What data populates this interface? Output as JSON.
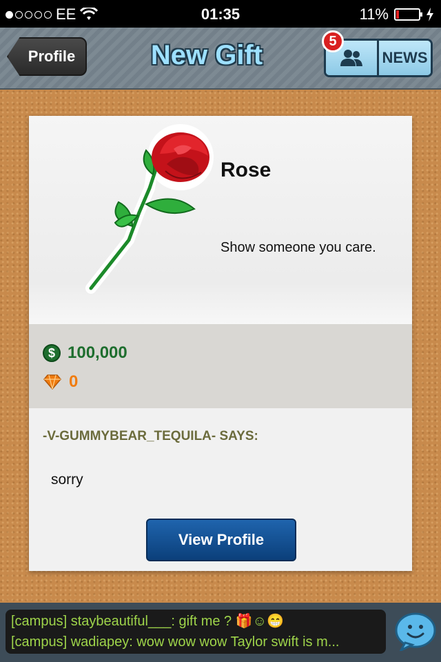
{
  "status_bar": {
    "carrier": "EE",
    "time": "01:35",
    "battery_percent": "11%",
    "battery_level": 0.11,
    "signal_bars_filled": 1,
    "signal_bars_total": 5
  },
  "nav": {
    "back_label": "Profile",
    "title": "New Gift",
    "news_label": "NEWS",
    "notification_count": "5"
  },
  "gift": {
    "name": "Rose",
    "description": "Show someone you care.",
    "cash_price": "100,000",
    "gem_price": "0"
  },
  "message": {
    "sender_says": "-V-GUMMYBEAR_TEQUILA- SAYS:",
    "text": "sorry",
    "view_profile_label": "View Profile"
  },
  "chat": {
    "lines": [
      "[campus] staybeautiful___: gift me ? 🎁☺😁",
      "[campus] wadiapey: wow wow wow Taylor swift is m..."
    ]
  },
  "colors": {
    "accent_title": "#9de0ff",
    "cash_green": "#1e6e2e",
    "gem_orange": "#f07c10",
    "button_blue": "#0b3f7a",
    "chat_green": "#9ed44a"
  }
}
